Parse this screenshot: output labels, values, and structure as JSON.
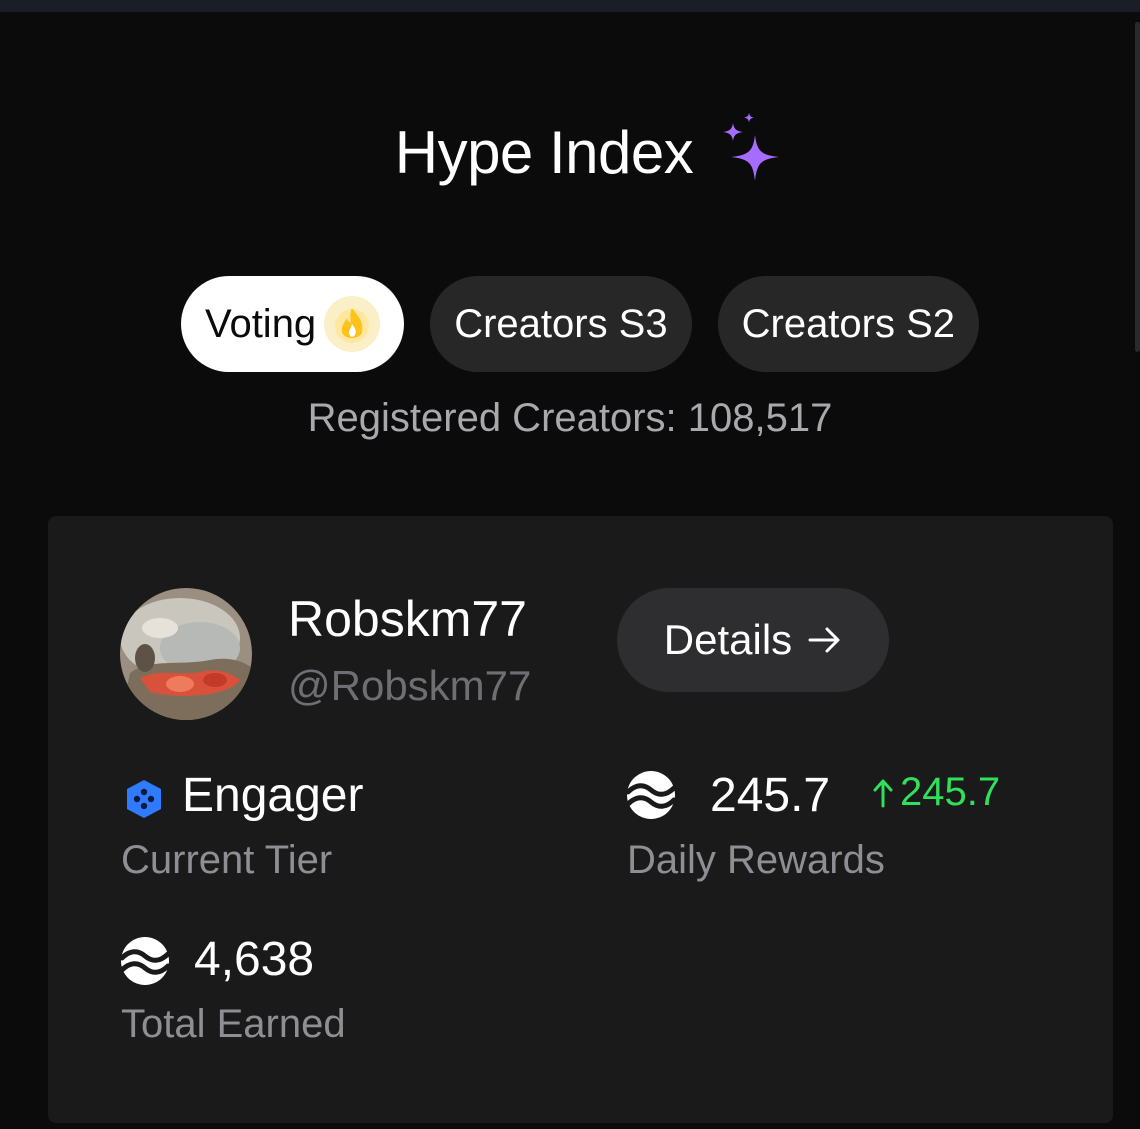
{
  "header": {
    "title": "Hype Index",
    "title_icon": "sparkles-icon"
  },
  "tabs": [
    {
      "label": "Voting",
      "active": true,
      "icon": "flame-icon"
    },
    {
      "label": "Creators S3",
      "active": false
    },
    {
      "label": "Creators S2",
      "active": false
    }
  ],
  "registered_creators": "Registered Creators: 108,517",
  "profile": {
    "name": "Robskm77",
    "handle": "@Robskm77",
    "details_label": "Details",
    "details_icon": "arrow-right-icon"
  },
  "stats": {
    "tier": {
      "value": "Engager",
      "label": "Current Tier",
      "icon": "hexagon-tier-icon"
    },
    "daily_rewards": {
      "value": "245.7",
      "change": "245.7",
      "label": "Daily Rewards",
      "icon": "hyperliquid-logo-icon"
    },
    "total_earned": {
      "value": "4,638",
      "label": "Total Earned",
      "icon": "hyperliquid-logo-icon"
    }
  },
  "colors": {
    "background": "#0b0b0c",
    "card": "#1a1a1b",
    "accent_purple": "#a66cff",
    "positive_green": "#2fe05a",
    "tier_blue": "#2f7bff"
  }
}
